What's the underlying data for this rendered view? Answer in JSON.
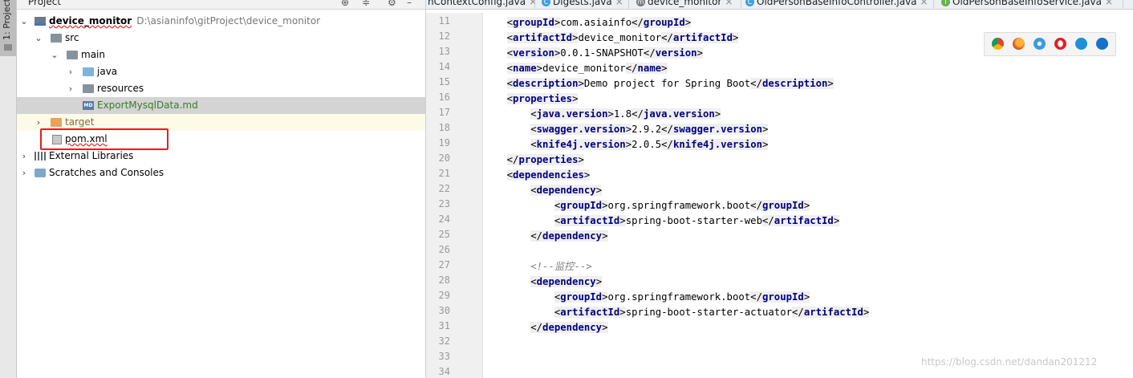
{
  "tool_strip": {
    "project_tab": "1: Project"
  },
  "project_pane": {
    "title": "Project",
    "tree": [
      {
        "label": "device_monitor",
        "path": "D:\\asianinfo\\gitProject\\device_monitor"
      },
      {
        "label": "src"
      },
      {
        "label": "main"
      },
      {
        "label": "java"
      },
      {
        "label": "resources"
      },
      {
        "label": "ExportMysqlData.md"
      },
      {
        "label": "target"
      },
      {
        "label": "pom.xml"
      },
      {
        "label": "External Libraries"
      },
      {
        "label": "Scratches and Consoles"
      }
    ]
  },
  "editor": {
    "tabs": [
      {
        "label": "nContextConfig.java"
      },
      {
        "label": "Digests.java"
      },
      {
        "label": "device_monitor"
      },
      {
        "label": "OldPersonBaseInfoController.java"
      },
      {
        "label": "OldPersonBaseInfoService.java"
      }
    ],
    "line_numbers": [
      "11",
      "12",
      "13",
      "14",
      "15",
      "16",
      "17",
      "18",
      "19",
      "20",
      "21",
      "22",
      "23",
      "24",
      "25",
      "26",
      "27",
      "28",
      "29",
      "30",
      "31",
      "32",
      "33",
      "34"
    ],
    "lines": [
      {
        "i": "    ",
        "o": "groupId",
        "t": "com.asiainfo",
        "c": "groupId"
      },
      {
        "i": "    ",
        "o": "artifactId",
        "t": "device_monitor",
        "c": "artifactId"
      },
      {
        "i": "    ",
        "o": "version",
        "t": "0.0.1-SNAPSHOT",
        "c": "version"
      },
      {
        "i": "    ",
        "o": "name",
        "t": "device_monitor",
        "c": "name"
      },
      {
        "i": "    ",
        "o": "description",
        "t": "Demo project for Spring Boot",
        "c": "description"
      },
      {
        "i": "    ",
        "o": "properties",
        "t": "",
        "c": ""
      },
      {
        "i": "        ",
        "o": "java.version",
        "t": "1.8",
        "c": "java.version"
      },
      {
        "i": "        ",
        "o": "swagger.version",
        "t": "2.9.2",
        "c": "swagger.version"
      },
      {
        "i": "        ",
        "o": "knife4j.version",
        "t": "2.0.5",
        "c": "knife4j.version"
      },
      {
        "i": "    ",
        "o": "",
        "t": "",
        "c": "properties"
      },
      {
        "i": "    ",
        "o": "dependencies",
        "t": "",
        "c": ""
      },
      {
        "i": "        ",
        "o": "dependency",
        "t": "",
        "c": ""
      },
      {
        "i": "            ",
        "o": "groupId",
        "t": "org.springframework.boot",
        "c": "groupId"
      },
      {
        "i": "            ",
        "o": "artifactId",
        "t": "spring-boot-starter-web",
        "c": "artifactId"
      },
      {
        "i": "        ",
        "o": "",
        "t": "",
        "c": "dependency"
      },
      {
        "i": "",
        "o": "",
        "t": "",
        "c": ""
      },
      {
        "i": "        ",
        "comment": "<!--监控-->"
      },
      {
        "i": "        ",
        "o": "dependency",
        "t": "",
        "c": ""
      },
      {
        "i": "            ",
        "o": "groupId",
        "t": "org.springframework.boot",
        "c": "groupId"
      },
      {
        "i": "            ",
        "o": "artifactId",
        "t": "spring-boot-starter-actuator",
        "c": "artifactId"
      },
      {
        "i": "        ",
        "o": "",
        "t": "",
        "c": "dependency"
      },
      {
        "i": "",
        "o": "",
        "t": "",
        "c": ""
      },
      {
        "i": "",
        "o": "",
        "t": "",
        "c": ""
      },
      {
        "i": "",
        "o": "",
        "t": "",
        "c": ""
      }
    ]
  },
  "browser_icons": [
    "chrome-icon",
    "firefox-icon",
    "safari-icon",
    "opera-icon",
    "ie-icon",
    "edge-icon"
  ],
  "watermark": "https://blog.csdn.net/dandan201212",
  "colors": {
    "tag": "#000080",
    "highlight_box": "#e02020",
    "selected_row": "#d4d4d4"
  }
}
